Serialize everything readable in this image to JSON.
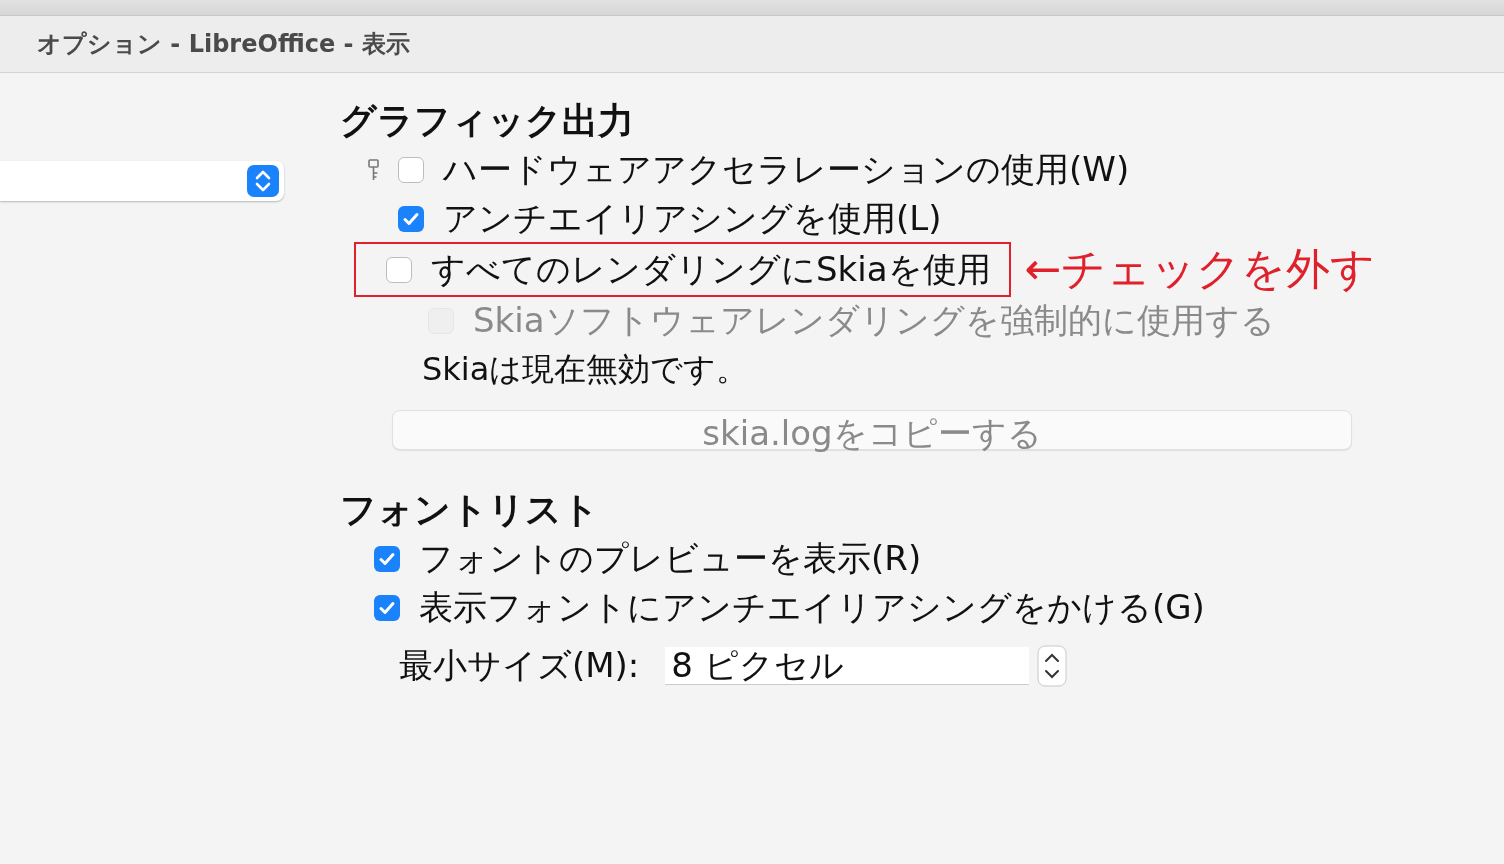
{
  "window": {
    "title": "オプション - LibreOffice - 表示"
  },
  "graphics_output": {
    "heading": "グラフィック出力",
    "options": [
      {
        "label": "ハードウェアアクセラレーションの使用(W)",
        "checked": false,
        "disabled": false,
        "locked": true
      },
      {
        "label": "アンチエイリアシングを使用(L)",
        "checked": true,
        "disabled": false
      },
      {
        "label": "すべてのレンダリングにSkiaを使用",
        "checked": false,
        "disabled": false,
        "callout": "←チェックを外す"
      },
      {
        "label": "Skiaソフトウェアレンダリングを強制的に使用する",
        "checked": false,
        "disabled": true,
        "sub": true
      }
    ],
    "status": "Skiaは現在無効です。",
    "button": {
      "label": "skia.logをコピーする",
      "disabled": true
    }
  },
  "font_list": {
    "heading": "フォントリスト",
    "options": [
      {
        "label": "フォントのプレビューを表示(R)",
        "checked": true,
        "disabled": false
      },
      {
        "label": "表示フォントにアンチエイリアシングをかける(G)",
        "checked": true,
        "disabled": false
      }
    ],
    "min_size": {
      "label": "最小サイズ(M):",
      "value": "8 ピクセル"
    }
  }
}
